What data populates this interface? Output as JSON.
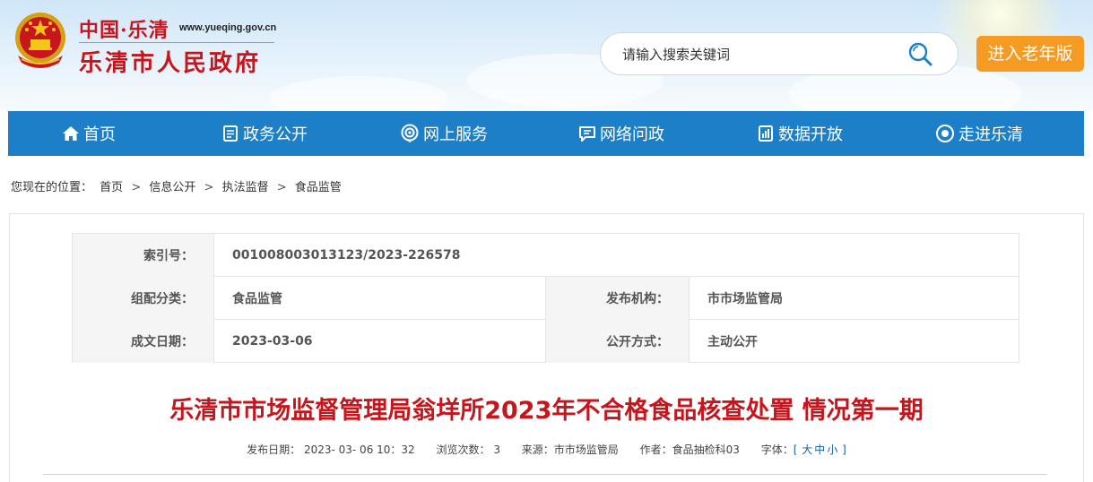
{
  "header": {
    "site_cn": "中国·乐清",
    "site_url": "www.yueqing.gov.cn",
    "site_title": "乐清市人民政府",
    "search_placeholder": "请输入搜索关键词",
    "elder_button": "进入老年版"
  },
  "nav": {
    "items": [
      {
        "label": "首页",
        "icon": "home-icon"
      },
      {
        "label": "政务公开",
        "icon": "document-icon"
      },
      {
        "label": "网上服务",
        "icon": "service-icon"
      },
      {
        "label": "网络问政",
        "icon": "chat-icon"
      },
      {
        "label": "数据开放",
        "icon": "data-icon"
      },
      {
        "label": "走进乐清",
        "icon": "eye-icon"
      }
    ]
  },
  "breadcrumb": {
    "prefix": "您现在的位置：",
    "items": [
      "首页",
      "信息公开",
      "执法监督",
      "食品监管"
    ]
  },
  "meta": {
    "index_label": "索引号：",
    "index_value": "001008003013123/2023-226578",
    "category_label": "组配分类：",
    "category_value": "食品监管",
    "publisher_label": "发布机构：",
    "publisher_value": "市市场监管局",
    "date_label": "成文日期：",
    "date_value": "2023-03-06",
    "mode_label": "公开方式：",
    "mode_value": "主动公开"
  },
  "article": {
    "title": "乐清市市场监督管理局翁垟所2023年不合格食品核查处置 情况第一期",
    "publish_date": "发布日期： 2023- 03- 06 10：32",
    "views": "浏览次数： 3",
    "source": "来源：市市场监管局",
    "author": "作者：食品抽检科03",
    "font_label": "字体：",
    "font_open": "[",
    "font_large": "大",
    "font_medium": "中",
    "font_small": "小",
    "font_close": "]"
  },
  "colors": {
    "brand_red": "#c4161c",
    "nav_blue": "#1d7fc7",
    "elder_orange": "#f59a23"
  }
}
